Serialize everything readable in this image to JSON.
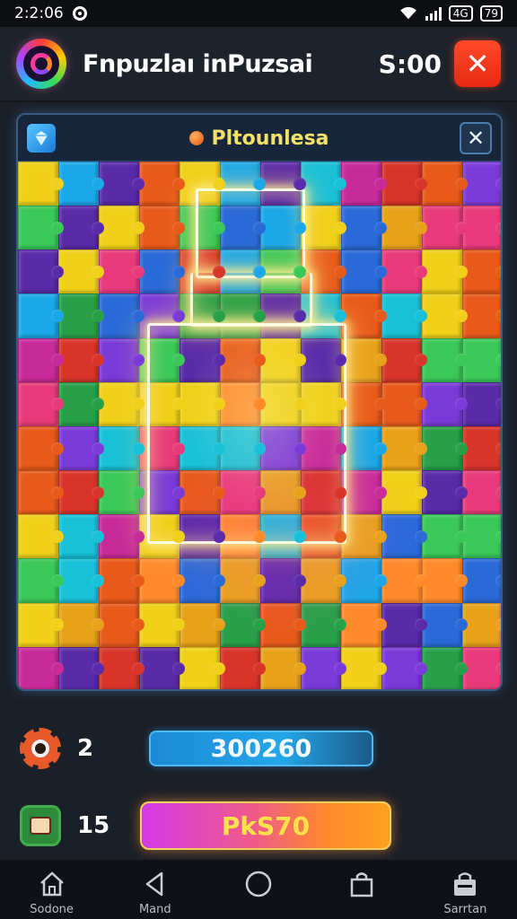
{
  "status_bar": {
    "time": "2:2:06",
    "badge_a": "4G",
    "badge_b": "79"
  },
  "header": {
    "title": "Fnpuzlaı inPuzsai",
    "score": "S:00"
  },
  "panel": {
    "title": "Pltounlesa"
  },
  "stats": {
    "gear_count": "2",
    "score_value": "300260",
    "leaf_count": "15",
    "action_label": "PkS70"
  },
  "nav": [
    {
      "label": "Sodone",
      "icon": "home-icon"
    },
    {
      "label": "Mand",
      "icon": "back-icon"
    },
    {
      "label": "",
      "icon": "circle-icon"
    },
    {
      "label": "",
      "icon": "bag-icon"
    },
    {
      "label": "Sarrtan",
      "icon": "shop-icon"
    }
  ],
  "colors": {
    "accent_red": "#ff4a2a",
    "score_blue": "#23a6e8",
    "play_gradient_start": "#d43ae8",
    "play_gradient_end": "#ffa020",
    "title_yellow": "#f3e26a"
  }
}
